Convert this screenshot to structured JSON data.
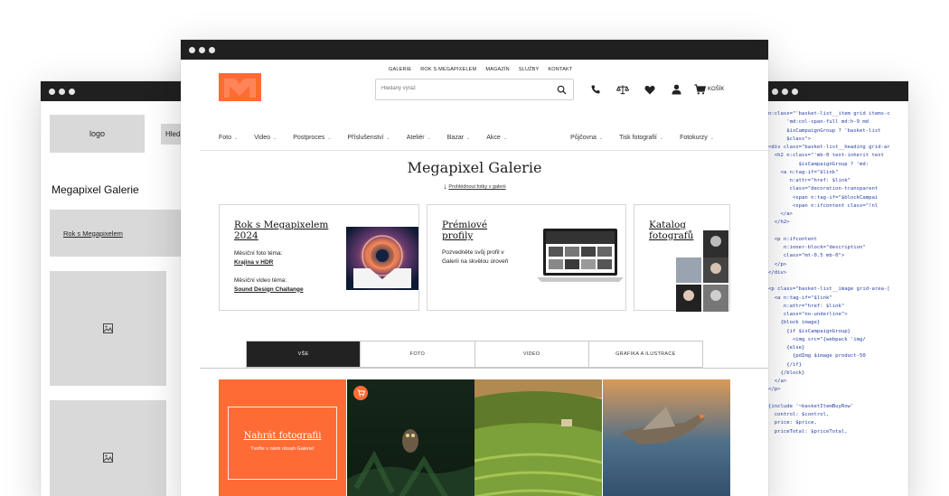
{
  "wireframe": {
    "logo_label": "logo",
    "search_stub": "Hled",
    "title": "Megapixel Galerie",
    "link": "Rok s Megapixelem"
  },
  "header": {
    "topnav": [
      "GALERIE",
      "ROK S MEGAPIXELEM",
      "MAGAZÍN",
      "SLUŽBY",
      "KONTAKT"
    ],
    "search_placeholder": "Hledaný výraz",
    "cart_label": "KOŠÍK"
  },
  "categories_left": [
    "Foto",
    "Video",
    "Postproces",
    "Příslušenství",
    "Ateliér",
    "Bazar",
    "Akce"
  ],
  "categories_right": [
    "Půjčovna",
    "Tisk fotografií",
    "Fotokurzy"
  ],
  "gallery": {
    "title": "Megapixel Galerie",
    "subtitle": "Prohlédnout fotky v galerii"
  },
  "cards": {
    "rok": {
      "title": "Rok s Megapixelem 2024",
      "photo_theme_label": "Měsíční foto téma:",
      "photo_theme": "Krajina v HDR",
      "video_theme_label": "Měsíční video téma:",
      "video_theme": "Sound Design Challange"
    },
    "premium": {
      "title": "Prémiové profily",
      "text": "Pozvedněte svůj profil v Galerii na skvělou úroveň"
    },
    "katalog": {
      "title": "Katalog fotografů"
    }
  },
  "tabs": [
    "VŠE",
    "FOTO",
    "VIDEO",
    "GRAFIKA A ILUSTRACE"
  ],
  "upload": {
    "title": "Nahrát fotografii",
    "subtitle": "Tvořte s námi obsah Galerie!"
  },
  "code_lines": [
    "n:class=\"'basket-list__item grid items-c",
    "      'md:col-span-full md:h-9 md",
    "      $isCampaignGroup ? 'basket-list",
    "      $class\">",
    "<div class=\"basket-list__heading grid-ar",
    "  <h2 n:class=\"'mb-0 text-inherit text",
    "          $isCampaignGroup ? 'md:",
    "    <a n:tag-if=\"$link\"",
    "       n:attr=\"href: $link\"",
    "       class=\"decoration-transparent",
    "        <span n:tag-if=\"$blockCampai",
    "        <span n:ifcontent class=\"!nl",
    "    </a>",
    "  </h2>",
    "",
    "  <p n:ifcontent",
    "     n:inner-block=\"description\"",
    "     class=\"mt-0.5 mb-0\">",
    "  </p>",
    "</div>",
    "",
    "<p class=\"basket-list__image grid-area-[",
    "  <a n:tag-if=\"$link\"",
    "     n:attr=\"href: $link\"",
    "     class=\"no-underline\">",
    "    {block image}",
    "      {if $isCampaignGroup}",
    "        <img src=\"{webpack 'img/",
    "      {else}",
    "        {pdImg $image product-50",
    "      {/if}",
    "    {/block}",
    "  </a>",
    "</p>",
    "",
    "{include '~basketItemBuyRow'",
    "  control: $control,",
    "  price: $price,",
    "  priceTotal: $priceTotal,"
  ],
  "colors": {
    "accent": "#ff6b35",
    "dark": "#202020",
    "code_blue": "#2a43a8"
  }
}
